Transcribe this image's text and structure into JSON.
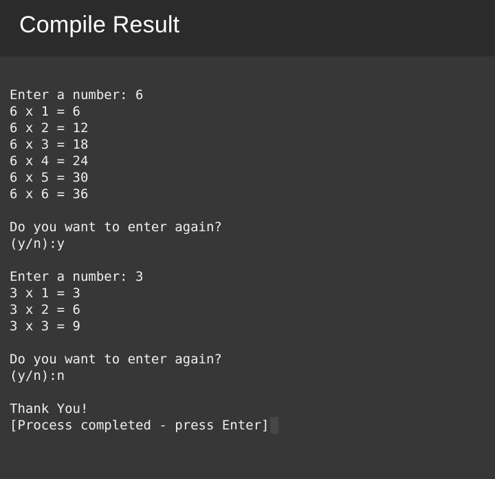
{
  "header": {
    "title": "Compile Result"
  },
  "terminal": {
    "lines": [
      "Enter a number: 6",
      "6 x 1 = 6",
      "6 x 2 = 12",
      "6 x 3 = 18",
      "6 x 4 = 24",
      "6 x 5 = 30",
      "6 x 6 = 36",
      "Do you want to enter again?",
      "(y/n):y",
      "Enter a number: 3",
      "3 x 1 = 3",
      "3 x 2 = 6",
      "3 x 3 = 9",
      "Do you want to enter again?",
      "(y/n):n",
      "Thank You!",
      "[Process completed - press Enter]"
    ]
  }
}
